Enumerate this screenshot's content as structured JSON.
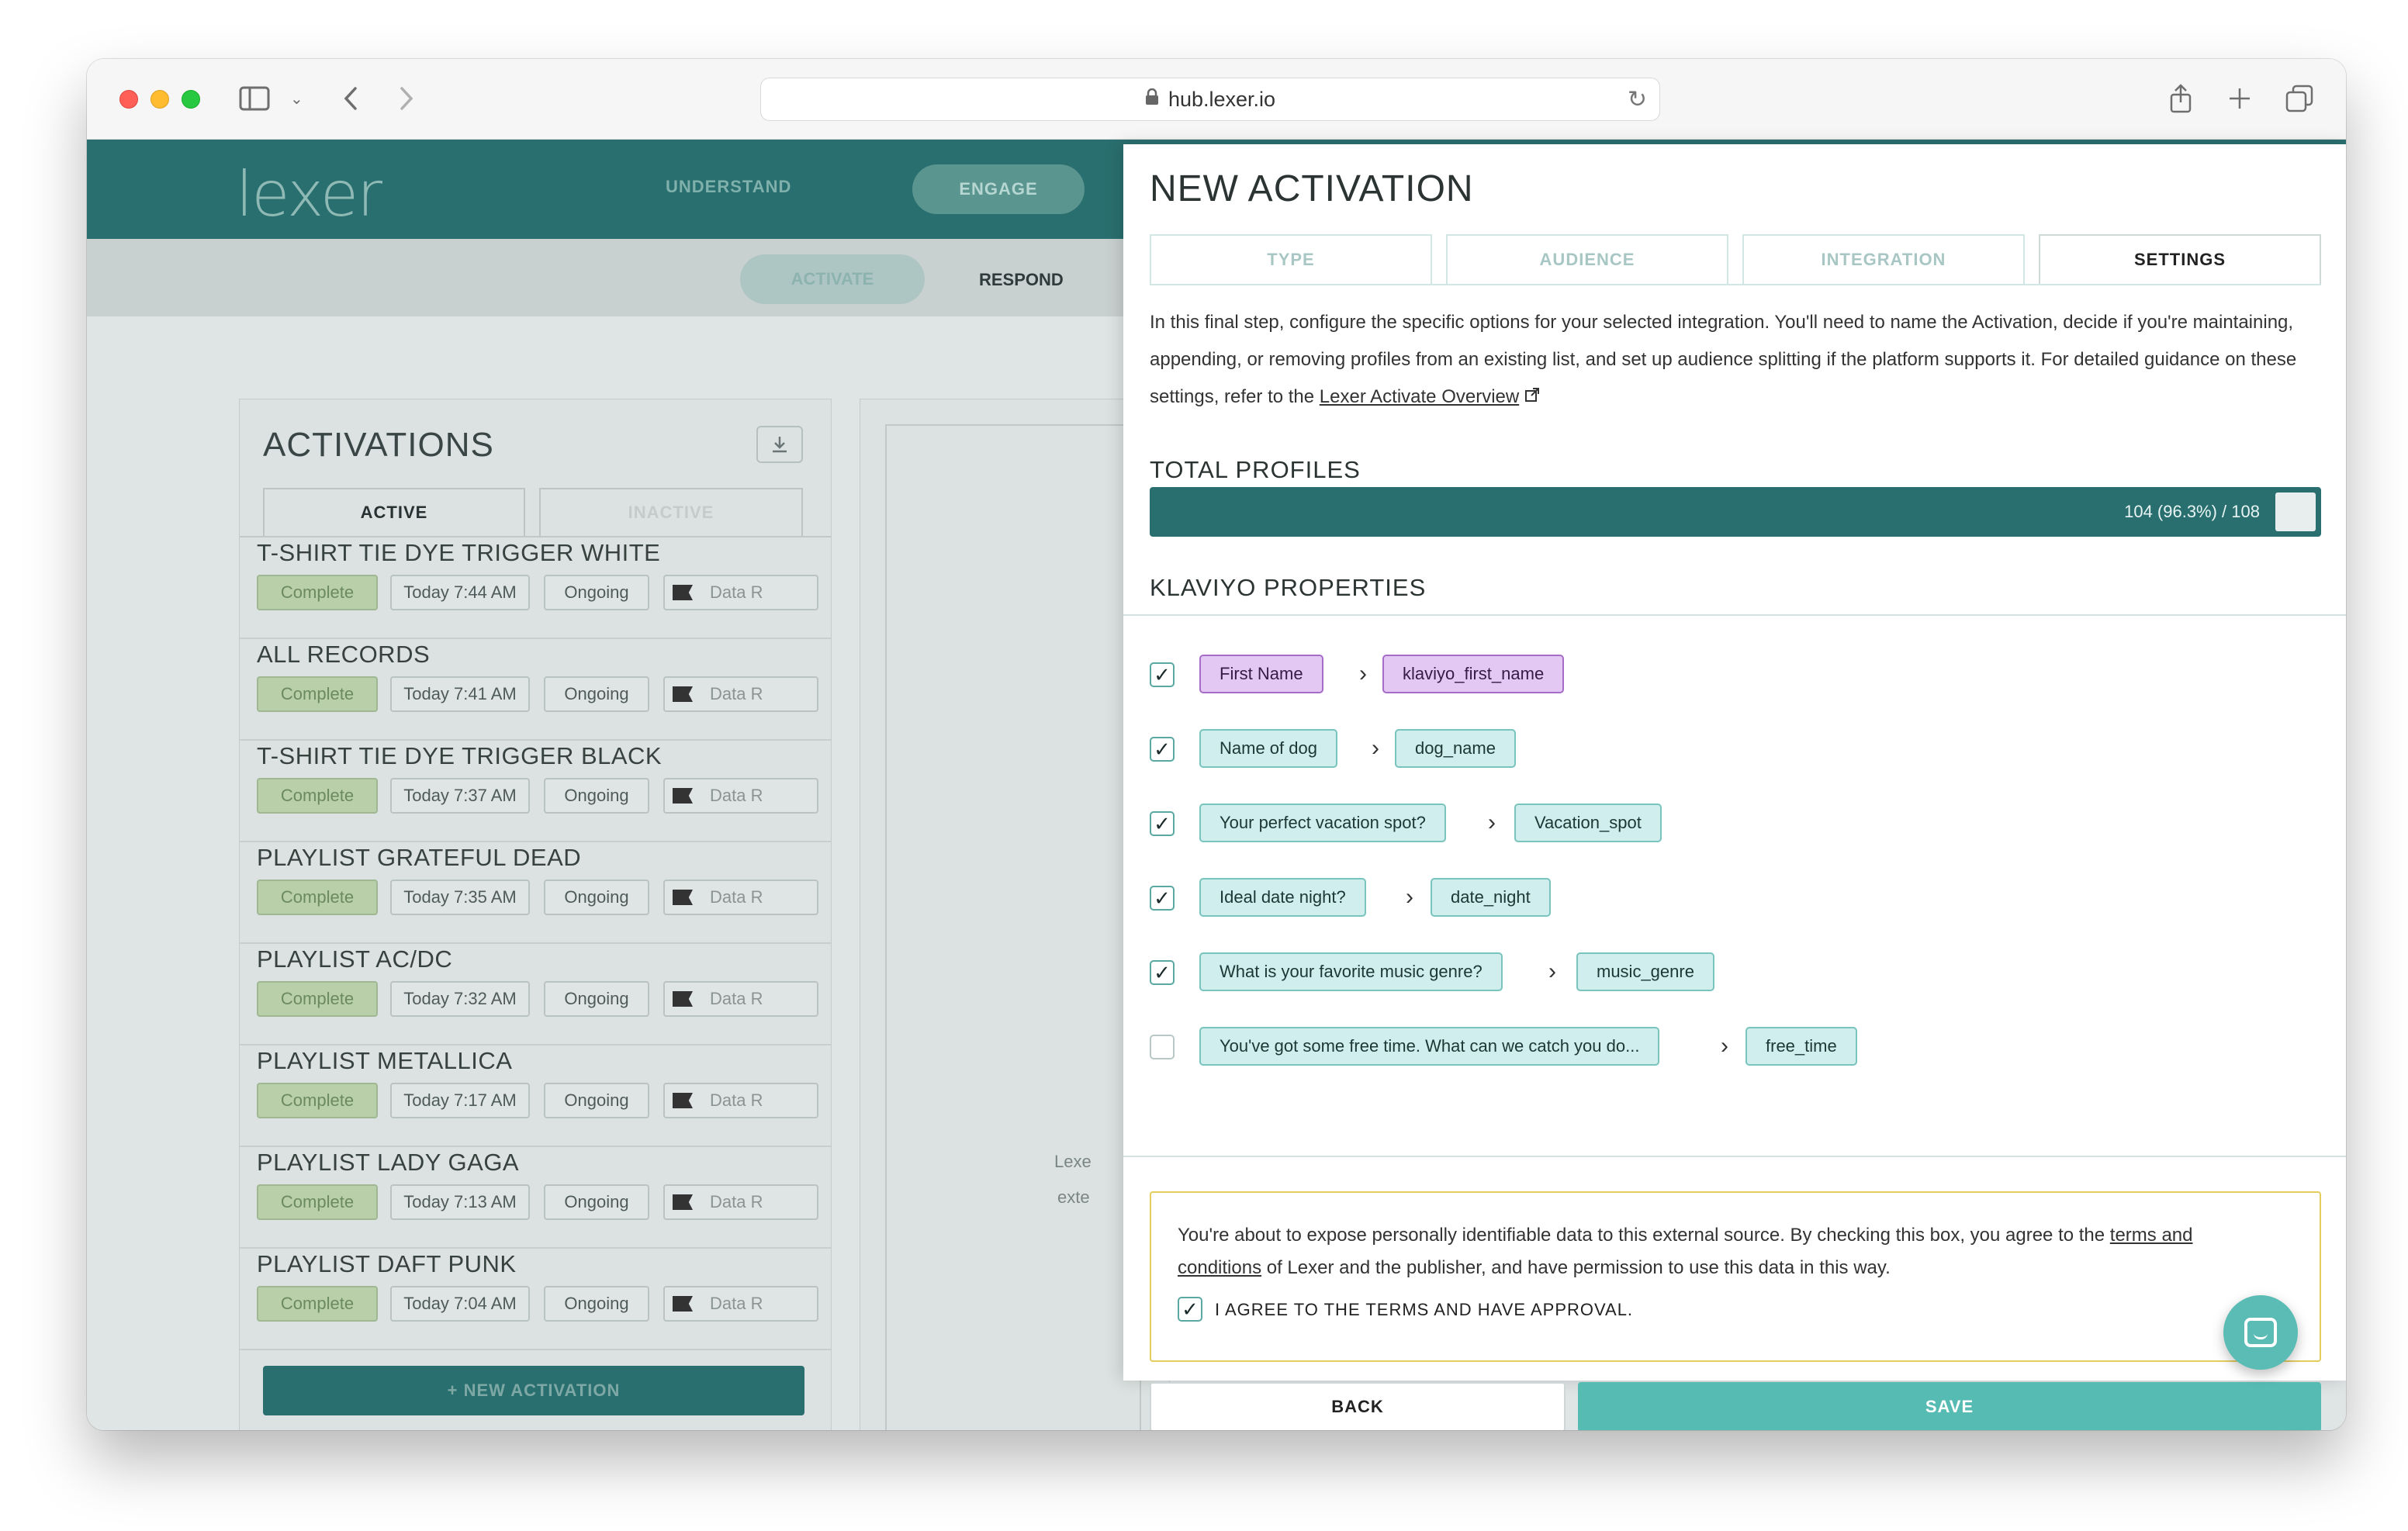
{
  "browser": {
    "url": "hub.lexer.io",
    "icons": [
      "sidebar-icon",
      "chevron-down-icon",
      "back-icon",
      "forward-icon",
      "lock-icon",
      "reload-icon",
      "share-icon",
      "plus-icon",
      "tabs-icon"
    ]
  },
  "app": {
    "logo": "lexer",
    "nav": {
      "understand": "UNDERSTAND",
      "engage": "ENGAGE"
    },
    "subnav": {
      "activate": "ACTIVATE",
      "respond": "RESPOND"
    }
  },
  "activations": {
    "title": "ACTIVATIONS",
    "tabs": {
      "active": "ACTIVE",
      "inactive": "INACTIVE"
    },
    "items": [
      {
        "name": "T-SHIRT TIE DYE TRIGGER WHITE",
        "status": "Complete",
        "time": "Today 7:44 AM",
        "mode": "Ongoing",
        "data": "Data R"
      },
      {
        "name": "ALL RECORDS",
        "status": "Complete",
        "time": "Today 7:41 AM",
        "mode": "Ongoing",
        "data": "Data R"
      },
      {
        "name": "T-SHIRT TIE DYE TRIGGER BLACK",
        "status": "Complete",
        "time": "Today 7:37 AM",
        "mode": "Ongoing",
        "data": "Data R"
      },
      {
        "name": "PLAYLIST GRATEFUL DEAD",
        "status": "Complete",
        "time": "Today 7:35 AM",
        "mode": "Ongoing",
        "data": "Data R"
      },
      {
        "name": "PLAYLIST AC/DC",
        "status": "Complete",
        "time": "Today 7:32 AM",
        "mode": "Ongoing",
        "data": "Data R"
      },
      {
        "name": "PLAYLIST METALLICA",
        "status": "Complete",
        "time": "Today 7:17 AM",
        "mode": "Ongoing",
        "data": "Data R"
      },
      {
        "name": "PLAYLIST LADY GAGA",
        "status": "Complete",
        "time": "Today 7:13 AM",
        "mode": "Ongoing",
        "data": "Data R"
      },
      {
        "name": "PLAYLIST DAFT PUNK",
        "status": "Complete",
        "time": "Today 7:04 AM",
        "mode": "Ongoing",
        "data": "Data R"
      }
    ],
    "new_button": "+ NEW ACTIVATION"
  },
  "middle": {
    "line1": "Lexe",
    "line2": "exte"
  },
  "modal": {
    "title": "NEW ACTIVATION",
    "tabs": [
      "TYPE",
      "AUDIENCE",
      "INTEGRATION",
      "SETTINGS"
    ],
    "selected_tab": "SETTINGS",
    "intro_text": "In this final step, configure the specific options for your selected integration. You'll need to name the Activation, decide if you're maintaining, appending, or removing profiles from an existing list, and set up audience splitting if the platform supports it. For detailed guidance on these settings, refer to the ",
    "intro_link": "Lexer Activate Overview",
    "total_profiles": {
      "label": "TOTAL PROFILES",
      "text": "104 (96.3%) / 108",
      "fraction": 0.963
    },
    "properties": {
      "label": "KLAVIYO PROPERTIES",
      "rows": [
        {
          "checked": true,
          "source": "First Name",
          "target": "klaviyo_first_name",
          "color": "purple"
        },
        {
          "checked": true,
          "source": "Name of dog",
          "target": "dog_name",
          "color": "teal"
        },
        {
          "checked": true,
          "source": "Your perfect vacation spot?",
          "target": "Vacation_spot",
          "color": "teal"
        },
        {
          "checked": true,
          "source": "Ideal date night?",
          "target": "date_night",
          "color": "teal"
        },
        {
          "checked": true,
          "source": "What is your favorite music genre?",
          "target": "music_genre",
          "color": "teal"
        },
        {
          "checked": false,
          "source": "You've got some free time. What can we catch you do...",
          "target": "free_time",
          "color": "teal"
        }
      ]
    },
    "consent": {
      "text_before": "You're about to expose personally identifiable data to this external source. By checking this box, you agree to the ",
      "link": "terms and conditions",
      "text_after": " of Lexer and the publisher, and have permission to use this data in this way.",
      "checkbox_label": "I AGREE TO THE TERMS AND HAVE APPROVAL.",
      "checked": true
    },
    "buttons": {
      "back": "BACK",
      "save": "SAVE"
    }
  },
  "colors": {
    "brand_teal": "#2a6f6f",
    "accent": "#56bbb3",
    "tag_purple": "#e3c8f4",
    "warning_border": "#e5cd5d"
  }
}
